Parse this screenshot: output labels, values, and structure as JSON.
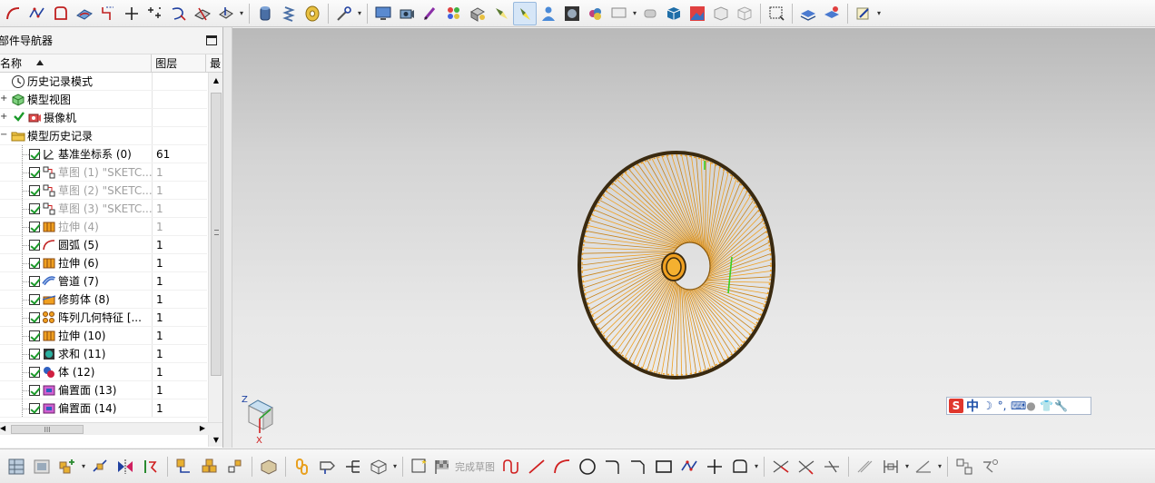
{
  "navigator": {
    "title": "部件导航器",
    "columns": {
      "name": "名称",
      "layer": "图层",
      "recent": "最"
    },
    "rows": [
      {
        "label": "历史记录模式",
        "layer": "",
        "icon": "clock-icon",
        "dim": false,
        "check": false,
        "expander": "",
        "indent": 0
      },
      {
        "label": "模型视图",
        "layer": "",
        "icon": "model-view-icon",
        "dim": false,
        "check": false,
        "expander": "+",
        "indent": 0
      },
      {
        "label": "摄像机",
        "layer": "",
        "icon": "camera-icon",
        "dim": false,
        "check": true,
        "expander": "+",
        "indent": 0
      },
      {
        "label": "模型历史记录",
        "layer": "",
        "icon": "folder-icon",
        "dim": false,
        "check": false,
        "expander": "−",
        "indent": 0
      },
      {
        "label": "基准坐标系 (0)",
        "layer": "61",
        "icon": "datum-csys-icon",
        "dim": false,
        "check": true,
        "expander": "",
        "indent": 1
      },
      {
        "label": "草图 (1) \"SKETC...",
        "layer": "1",
        "icon": "sketch-icon",
        "dim": true,
        "check": true,
        "expander": "",
        "indent": 1
      },
      {
        "label": "草图 (2) \"SKETC...",
        "layer": "1",
        "icon": "sketch-icon",
        "dim": true,
        "check": true,
        "expander": "",
        "indent": 1
      },
      {
        "label": "草图 (3) \"SKETC...",
        "layer": "1",
        "icon": "sketch-icon",
        "dim": true,
        "check": true,
        "expander": "",
        "indent": 1
      },
      {
        "label": "拉伸 (4)",
        "layer": "1",
        "icon": "extrude-icon",
        "dim": true,
        "check": true,
        "expander": "",
        "indent": 1
      },
      {
        "label": "圆弧 (5)",
        "layer": "1",
        "icon": "arc-icon",
        "dim": false,
        "check": true,
        "expander": "",
        "indent": 1
      },
      {
        "label": "拉伸 (6)",
        "layer": "1",
        "icon": "extrude-icon",
        "dim": false,
        "check": true,
        "expander": "",
        "indent": 1
      },
      {
        "label": "管道 (7)",
        "layer": "1",
        "icon": "tube-icon",
        "dim": false,
        "check": true,
        "expander": "",
        "indent": 1
      },
      {
        "label": "修剪体 (8)",
        "layer": "1",
        "icon": "trim-body-icon",
        "dim": false,
        "check": true,
        "expander": "",
        "indent": 1
      },
      {
        "label": "阵列几何特征 [...",
        "layer": "1",
        "icon": "pattern-icon",
        "dim": false,
        "check": true,
        "expander": "",
        "indent": 1
      },
      {
        "label": "拉伸 (10)",
        "layer": "1",
        "icon": "extrude-icon",
        "dim": false,
        "check": true,
        "expander": "",
        "indent": 1
      },
      {
        "label": "求和 (11)",
        "layer": "1",
        "icon": "unite-icon",
        "dim": false,
        "check": true,
        "expander": "",
        "indent": 1
      },
      {
        "label": "体 (12)",
        "layer": "1",
        "icon": "body-icon",
        "dim": false,
        "check": true,
        "expander": "",
        "indent": 1
      },
      {
        "label": "偏置面 (13)",
        "layer": "1",
        "icon": "offset-face-icon",
        "dim": false,
        "check": true,
        "expander": "",
        "indent": 1
      },
      {
        "label": "偏置面 (14)",
        "layer": "1",
        "icon": "offset-face-icon",
        "dim": false,
        "check": true,
        "expander": "",
        "indent": 1
      }
    ],
    "hscroll_label": "III"
  },
  "viewport": {
    "triad": {
      "z": "Z",
      "x": "X"
    },
    "ime": {
      "logo": "S",
      "mode": "中"
    }
  },
  "bottom_toolbar": {
    "finish_sketch": "完成草图"
  },
  "colors": {
    "accent": "#d6e6f7",
    "model_orange": "#f0a020",
    "model_dark": "#3a2a10",
    "check_green": "#1b9a2a"
  }
}
